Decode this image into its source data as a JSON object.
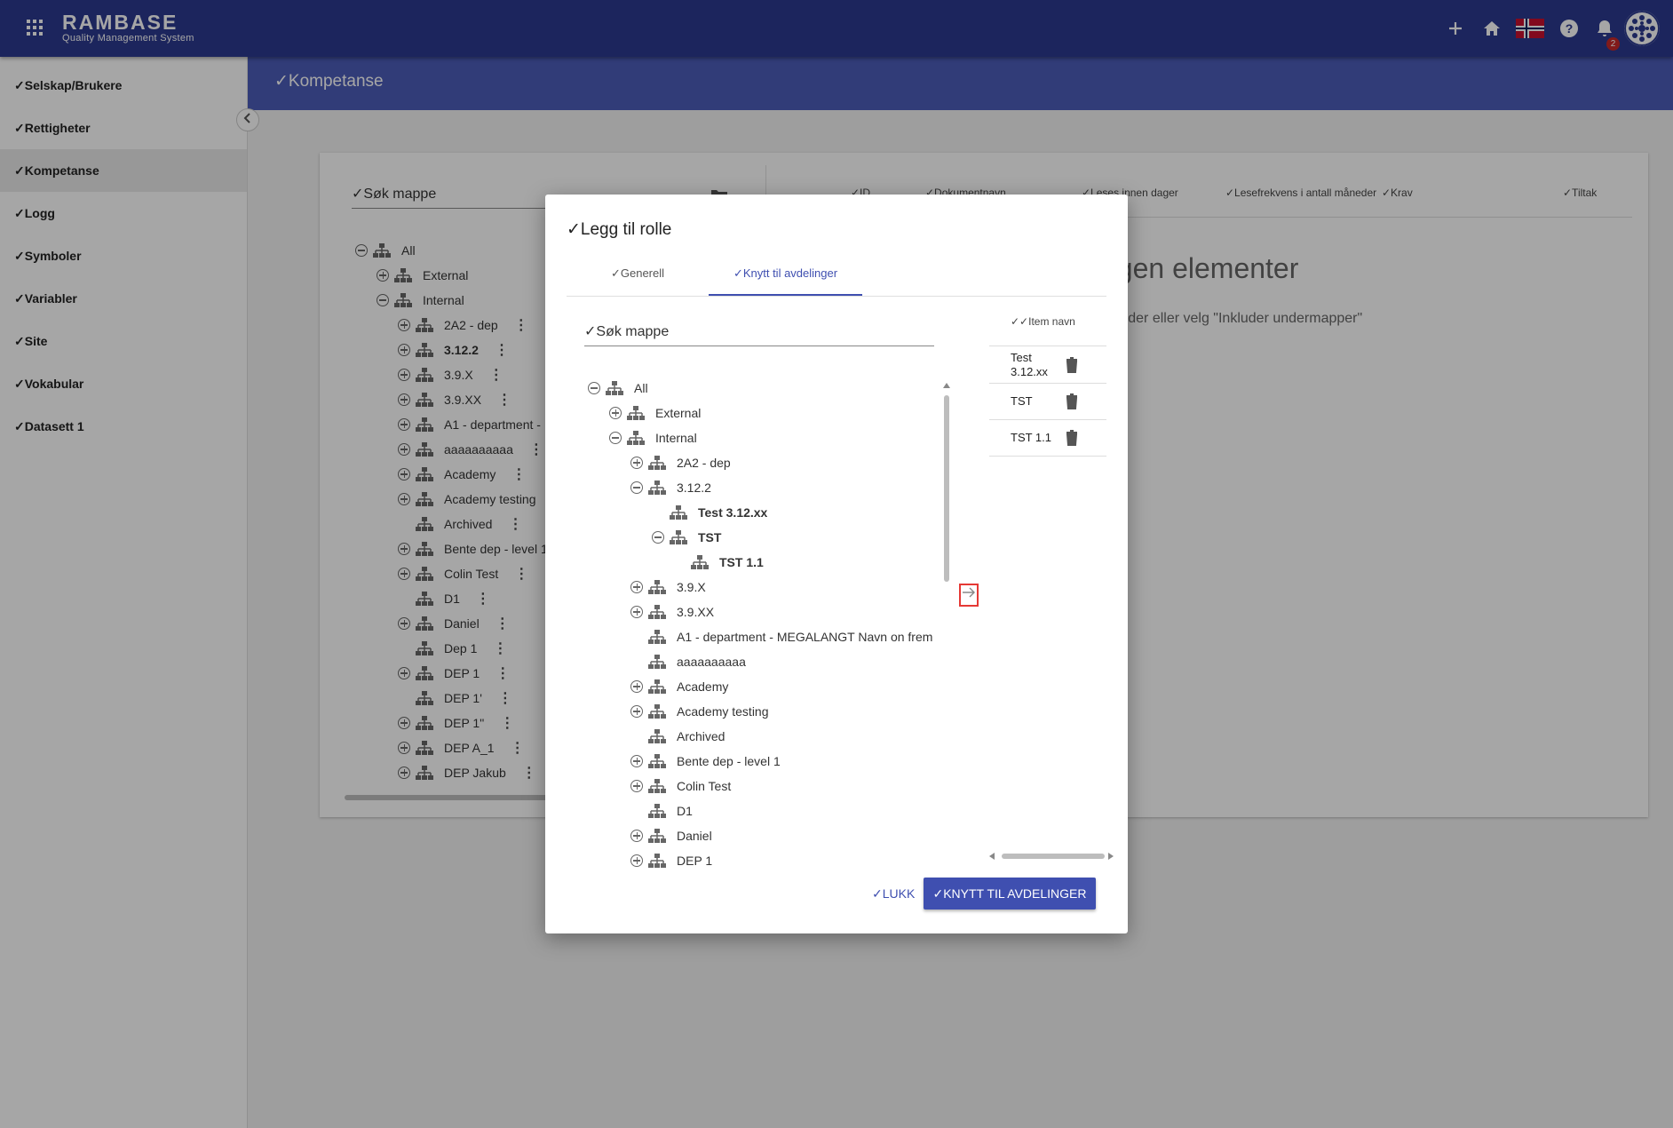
{
  "app": {
    "logo": "RAMBASE",
    "subtitle": "Quality Management System",
    "notification_count": "2"
  },
  "sidebar": {
    "items": [
      "✓Selskap/Brukere",
      "✓Rettigheter",
      "✓Kompetanse",
      "✓Logg",
      "✓Symboler",
      "✓Variabler",
      "✓Site",
      "✓Vokabular",
      "✓Datasett 1"
    ],
    "active": "✓Kompetanse"
  },
  "page": {
    "title": "✓Kompetanse",
    "search_placeholder": "✓Søk mappe",
    "columns": [
      "✓ID",
      "✓Dokumentnavn",
      "✓Leses innen dager",
      "✓Lesefrekvens i antall måneder",
      "✓Krav",
      "✓Tiltak"
    ],
    "empty_title": "ngen elementer",
    "empty_sub": "n folder eller velg \"Inkluder undermapper\"",
    "tree": [
      {
        "label": "All",
        "depth": 0,
        "toggle": "minus",
        "kebab": false
      },
      {
        "label": "External",
        "depth": 1,
        "toggle": "plus",
        "kebab": false
      },
      {
        "label": "Internal",
        "depth": 1,
        "toggle": "minus",
        "kebab": false
      },
      {
        "label": "2A2 - dep",
        "depth": 2,
        "toggle": "plus",
        "kebab": true
      },
      {
        "label": "3.12.2",
        "depth": 2,
        "toggle": "plus",
        "kebab": true,
        "bold": true
      },
      {
        "label": "3.9.X",
        "depth": 2,
        "toggle": "plus",
        "kebab": true
      },
      {
        "label": "3.9.XX",
        "depth": 2,
        "toggle": "plus",
        "kebab": true
      },
      {
        "label": "A1 - department - ",
        "depth": 2,
        "toggle": "plus",
        "kebab": false
      },
      {
        "label": "aaaaaaaaaa",
        "depth": 2,
        "toggle": "plus",
        "kebab": true
      },
      {
        "label": "Academy",
        "depth": 2,
        "toggle": "plus",
        "kebab": true
      },
      {
        "label": "Academy testing",
        "depth": 2,
        "toggle": "plus",
        "kebab": false
      },
      {
        "label": "Archived",
        "depth": 2,
        "toggle": "none",
        "kebab": true
      },
      {
        "label": "Bente dep - level 1",
        "depth": 2,
        "toggle": "plus",
        "kebab": false
      },
      {
        "label": "Colin Test",
        "depth": 2,
        "toggle": "plus",
        "kebab": true
      },
      {
        "label": "D1",
        "depth": 2,
        "toggle": "none",
        "kebab": true
      },
      {
        "label": "Daniel",
        "depth": 2,
        "toggle": "plus",
        "kebab": true
      },
      {
        "label": "Dep 1",
        "depth": 2,
        "toggle": "none",
        "kebab": true
      },
      {
        "label": "DEP 1",
        "depth": 2,
        "toggle": "plus",
        "kebab": true
      },
      {
        "label": "DEP 1'",
        "depth": 2,
        "toggle": "none",
        "kebab": true
      },
      {
        "label": "DEP 1\"",
        "depth": 2,
        "toggle": "plus",
        "kebab": true
      },
      {
        "label": "DEP A_1",
        "depth": 2,
        "toggle": "plus",
        "kebab": true
      },
      {
        "label": "DEP Jakub",
        "depth": 2,
        "toggle": "plus",
        "kebab": true
      }
    ]
  },
  "dialog": {
    "title": "✓Legg til rolle",
    "tabs": [
      "✓Generell",
      "✓Knytt til avdelinger"
    ],
    "active_tab": "✓Knytt til avdelinger",
    "search_placeholder": "✓Søk mappe",
    "tree": [
      {
        "label": "All",
        "depth": 0,
        "toggle": "minus"
      },
      {
        "label": "External",
        "depth": 1,
        "toggle": "plus"
      },
      {
        "label": "Internal",
        "depth": 1,
        "toggle": "minus"
      },
      {
        "label": "2A2 - dep",
        "depth": 2,
        "toggle": "plus"
      },
      {
        "label": "3.12.2",
        "depth": 2,
        "toggle": "minus"
      },
      {
        "label": "Test 3.12.xx",
        "depth": 3,
        "toggle": "none",
        "bold": true
      },
      {
        "label": "TST",
        "depth": 3,
        "toggle": "minus",
        "bold": true
      },
      {
        "label": "TST 1.1",
        "depth": 4,
        "toggle": "none",
        "bold": true
      },
      {
        "label": "3.9.X",
        "depth": 2,
        "toggle": "plus"
      },
      {
        "label": "3.9.XX",
        "depth": 2,
        "toggle": "plus"
      },
      {
        "label": "A1 - department - MEGALANGT Navn on frem",
        "depth": 2,
        "toggle": "none"
      },
      {
        "label": "aaaaaaaaaa",
        "depth": 2,
        "toggle": "none"
      },
      {
        "label": "Academy",
        "depth": 2,
        "toggle": "plus"
      },
      {
        "label": "Academy testing",
        "depth": 2,
        "toggle": "plus"
      },
      {
        "label": "Archived",
        "depth": 2,
        "toggle": "none"
      },
      {
        "label": "Bente dep - level 1",
        "depth": 2,
        "toggle": "plus"
      },
      {
        "label": "Colin Test",
        "depth": 2,
        "toggle": "plus"
      },
      {
        "label": "D1",
        "depth": 2,
        "toggle": "none"
      },
      {
        "label": "Daniel",
        "depth": 2,
        "toggle": "plus"
      },
      {
        "label": "DEP 1",
        "depth": 2,
        "toggle": "plus"
      }
    ],
    "selected_header": "✓✓Item navn",
    "selected": [
      "Test 3.12.xx",
      "TST",
      "TST 1.1"
    ],
    "close_label": "✓LUKK",
    "submit_label": "✓KNYTT TIL AVDELINGER"
  }
}
